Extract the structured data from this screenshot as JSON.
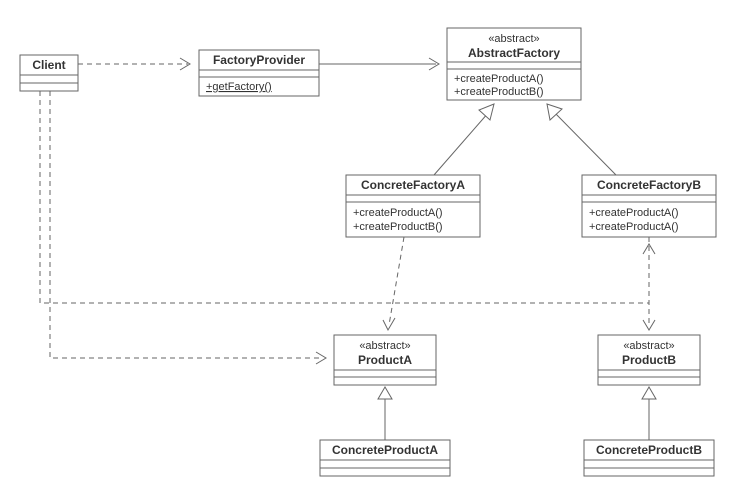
{
  "diagram": {
    "type": "uml-class",
    "pattern": "Abstract Factory"
  },
  "classes": {
    "client": {
      "name": "Client"
    },
    "factoryProvider": {
      "name": "FactoryProvider",
      "methods": [
        "+getFactory()"
      ],
      "static_methods": [
        true
      ]
    },
    "abstractFactory": {
      "stereotype": "«abstract»",
      "name": "AbstractFactory",
      "methods": [
        "+createProductA()",
        "+createProductB()"
      ]
    },
    "concreteFactoryA": {
      "name": "ConcreteFactoryA",
      "methods": [
        "+createProductA()",
        "+createProductB()"
      ]
    },
    "concreteFactoryB": {
      "name": "ConcreteFactoryB",
      "methods": [
        "+createProductA()",
        "+createProductA()"
      ]
    },
    "productA": {
      "stereotype": "«abstract»",
      "name": "ProductA"
    },
    "productB": {
      "stereotype": "«abstract»",
      "name": "ProductB"
    },
    "concreteProductA": {
      "name": "ConcreteProductA"
    },
    "concreteProductB": {
      "name": "ConcreteProductB"
    }
  },
  "relationships": [
    {
      "from": "Client",
      "to": "FactoryProvider",
      "type": "dependency"
    },
    {
      "from": "FactoryProvider",
      "to": "AbstractFactory",
      "type": "association"
    },
    {
      "from": "ConcreteFactoryA",
      "to": "AbstractFactory",
      "type": "generalization"
    },
    {
      "from": "ConcreteFactoryB",
      "to": "AbstractFactory",
      "type": "generalization"
    },
    {
      "from": "Client",
      "to": "AbstractFactory",
      "type": "dependency"
    },
    {
      "from": "Client",
      "to": "ProductA",
      "type": "dependency"
    },
    {
      "from": "ConcreteFactoryA",
      "to": "ProductA",
      "type": "dependency"
    },
    {
      "from": "ConcreteFactoryB",
      "to": "ProductB",
      "type": "dependency"
    },
    {
      "from": "ConcreteProductA",
      "to": "ProductA",
      "type": "generalization"
    },
    {
      "from": "ConcreteProductB",
      "to": "ProductB",
      "type": "generalization"
    }
  ]
}
